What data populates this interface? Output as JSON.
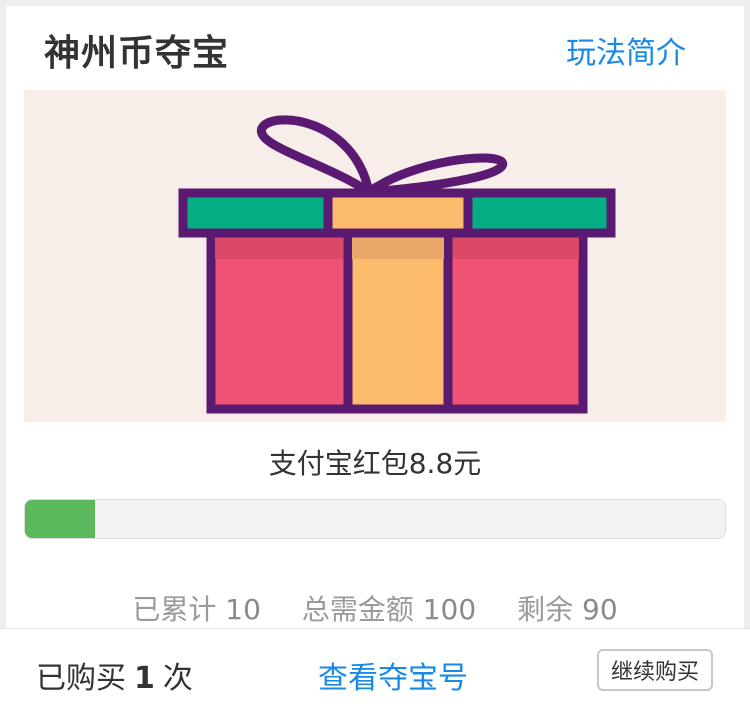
{
  "header": {
    "title": "神州币夺宝",
    "rules_link": "玩法简介"
  },
  "prize": {
    "name": "支付宝红包8.8元",
    "image_icon": "gift-box-icon",
    "progress_fraction": 0.1
  },
  "stats": {
    "accumulated_label": "已累计",
    "accumulated_value": "10",
    "total_label": "总需金额",
    "total_value": "100",
    "remaining_label": "剩余",
    "remaining_value": "90"
  },
  "footer": {
    "bought_prefix": "已购买",
    "bought_count": "1",
    "bought_suffix": "次",
    "view_numbers_link": "查看夺宝号",
    "continue_button": "继续购买"
  },
  "colors": {
    "accent_blue": "#1a88e6",
    "progress_green": "#5cb85c",
    "banner_bg": "#f7ede9",
    "gift_outline": "#5b1a72",
    "gift_box": "#ef5272",
    "gift_ribbon": "#fcbb6d",
    "gift_lid_green": "#05ae83"
  }
}
